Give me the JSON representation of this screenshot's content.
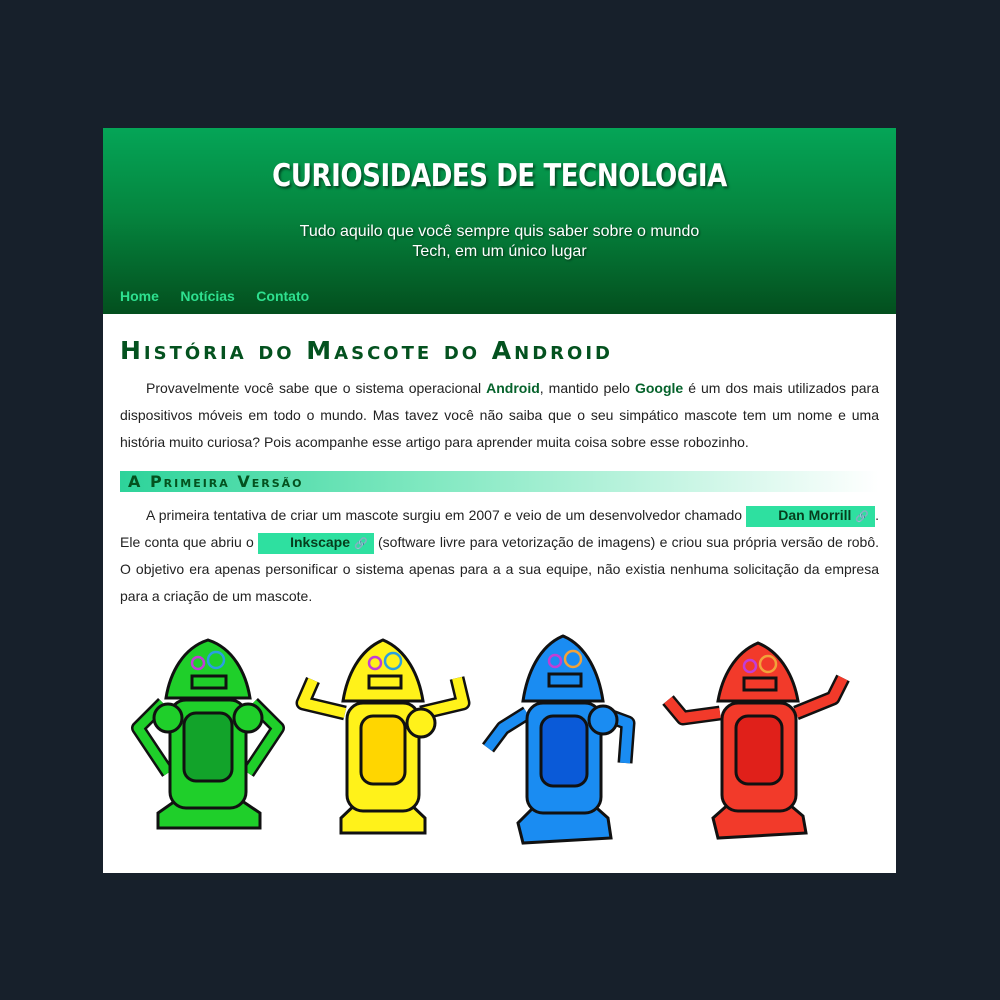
{
  "header": {
    "title": "CURIOSIDADES DE TECNOLOGIA",
    "subtitle": "Tudo aquilo que você sempre quis saber sobre o mundo Tech, em um único lugar"
  },
  "nav": [
    {
      "label": "Home"
    },
    {
      "label": "Notícias"
    },
    {
      "label": "Contato"
    }
  ],
  "article": {
    "title": "História do Mascote do Android",
    "intro": {
      "t1": "Provavelmente você sabe que o sistema operacional ",
      "android": "Android",
      "t2": ", mantido pelo ",
      "google": "Google",
      "t3": " é um dos mais utilizados para dispositivos móveis em todo o mundo. Mas tavez você não saiba que o seu simpático mascote tem um nome e uma história muito curiosa? Pois acompanhe esse artigo para aprender muita coisa sobre esse robozinho."
    },
    "section1": {
      "title": "A Primeira Versão",
      "t1": "A primeira tentativa de criar um mascote surgiu em 2007 e veio de um desenvolvedor chamado ",
      "link1": "Dan Morrill",
      "t2": ". Ele conta que abriu o ",
      "link2": "Inkscape",
      "t3": " (software livre para vetorização de imagens) e criou sua própria versão de robô. O objetivo era apenas personificar o sistema apenas para a a sua equipe, não existia nenhuma solicitação da empresa para a criação de um mascote."
    }
  },
  "illustration": {
    "robots": [
      {
        "name": "green-robot",
        "body": "#1fcf2a",
        "belly": "#12a32a"
      },
      {
        "name": "yellow-robot",
        "body": "#fff21a",
        "belly": "#ffd600"
      },
      {
        "name": "blue-robot",
        "body": "#1a8cf2",
        "belly": "#0a5ad8"
      },
      {
        "name": "red-robot",
        "body": "#f23a2a",
        "belly": "#e0201a"
      }
    ]
  },
  "colors": {
    "header_top": "#05a557",
    "header_bottom": "#034f1e",
    "nav_link": "#2ee08f",
    "heading": "#04521f",
    "link_bg": "#2ee0a0",
    "page_bg": "#17202b"
  }
}
